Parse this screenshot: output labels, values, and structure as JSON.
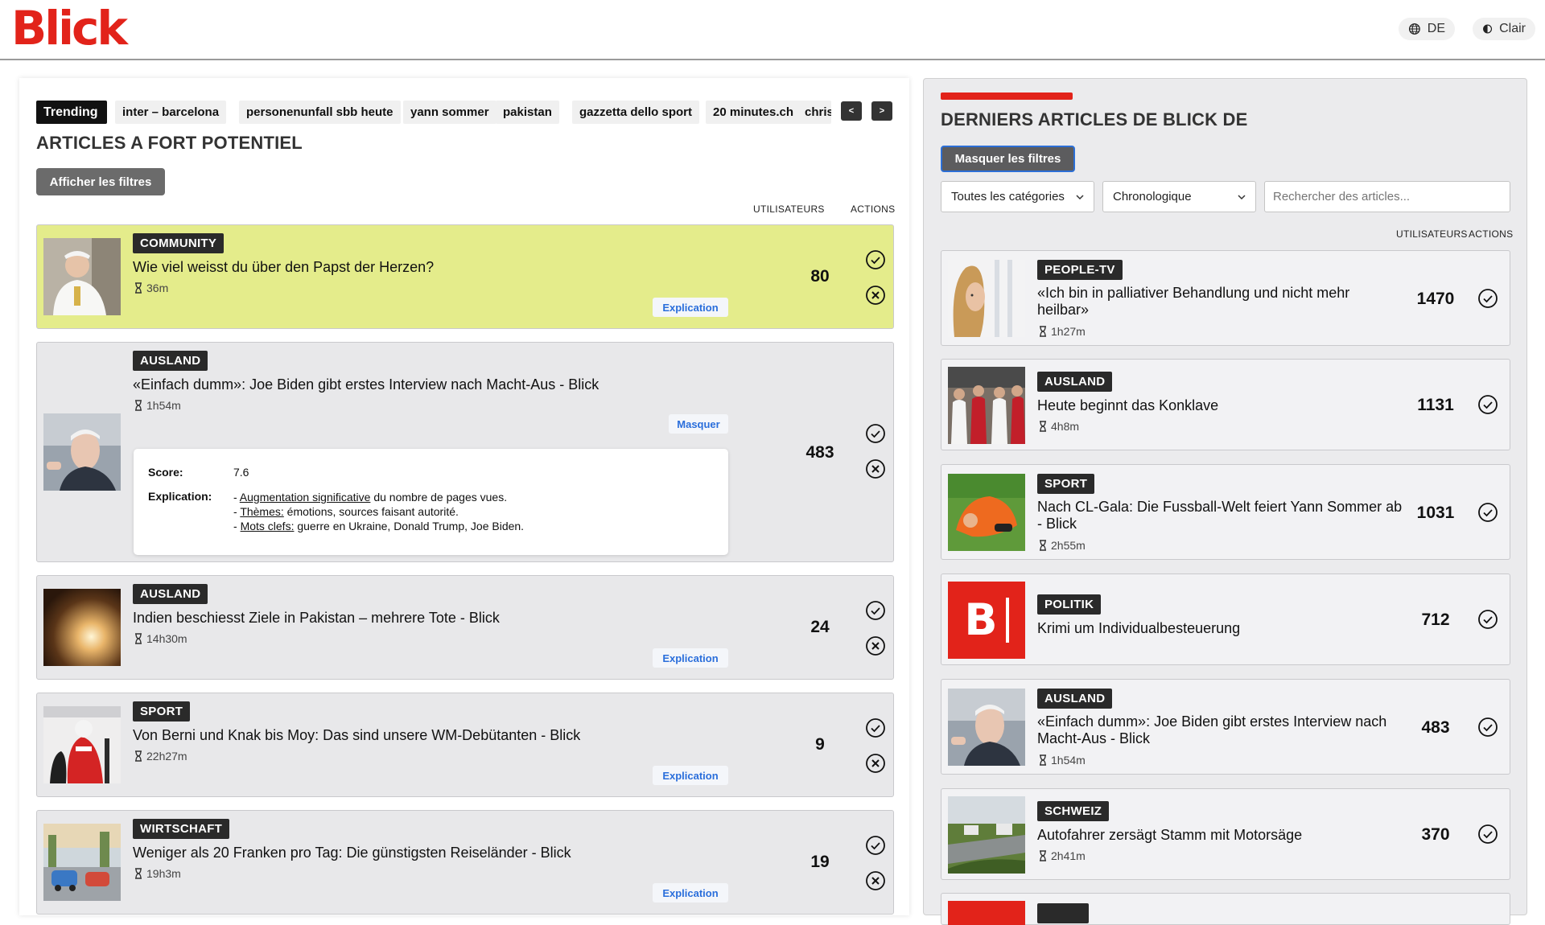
{
  "header": {
    "logo": "Blick",
    "language": "DE",
    "theme": "Clair"
  },
  "trending": {
    "label": "Trending",
    "tags": [
      "inter – barcelona",
      "personenunfall sbb heute",
      "yann sommer",
      "pakistan",
      "gazzetta dello sport",
      "20 minutes.ch",
      "chris"
    ],
    "prev": "<",
    "next": ">"
  },
  "left": {
    "title": "ARTICLES A FORT POTENTIEL",
    "filters_button": "Afficher les filtres",
    "col_users": "UTILISATEURS",
    "col_actions": "ACTIONS",
    "articles": [
      {
        "category": "COMMUNITY",
        "title": "Wie viel weisst du über den Papst der Herzen?",
        "age": "36m",
        "users": "80",
        "button": "Explication"
      },
      {
        "category": "AUSLAND",
        "title": "«Einfach dumm»: Joe Biden gibt erstes Interview nach Macht-Aus - Blick",
        "age": "1h54m",
        "users": "483",
        "button": "Masquer",
        "explanation": {
          "score_label": "Score:",
          "score": "7.6",
          "expl_label": "Explication:",
          "lines": [
            {
              "prefix": "- ",
              "term": "Augmentation significative",
              "rest": " du nombre de pages vues."
            },
            {
              "prefix": "- ",
              "term": "Thèmes:",
              "rest": " émotions, sources faisant autorité."
            },
            {
              "prefix": "- ",
              "term": "Mots clefs:",
              "rest": " guerre en Ukraine, Donald Trump, Joe Biden."
            }
          ]
        }
      },
      {
        "category": "AUSLAND",
        "title": "Indien beschiesst Ziele in Pakistan – mehrere Tote - Blick",
        "age": "14h30m",
        "users": "24",
        "button": "Explication"
      },
      {
        "category": "SPORT",
        "title": "Von Berni und Knak bis Moy: Das sind unsere WM-Debütanten - Blick",
        "age": "22h27m",
        "users": "9",
        "button": "Explication"
      },
      {
        "category": "WIRTSCHAFT",
        "title": "Weniger als 20 Franken pro Tag: Die günstigsten Reiseländer - Blick",
        "age": "19h3m",
        "users": "19",
        "button": "Explication"
      }
    ]
  },
  "right": {
    "title": "DERNIERS ARTICLES DE BLICK DE",
    "filters_button": "Masquer les filtres",
    "category_select": "Toutes les catégories",
    "order_select": "Chronologique",
    "search_placeholder": "Rechercher des articles...",
    "col_users": "UTILISATEURS",
    "col_actions": "ACTIONS",
    "articles": [
      {
        "category": "PEOPLE-TV",
        "title": "«Ich bin in palliativer Behandlung und nicht mehr heilbar»",
        "age": "1h27m",
        "users": "1470"
      },
      {
        "category": "AUSLAND",
        "title": "Heute beginnt das Konklave",
        "age": "4h8m",
        "users": "1131"
      },
      {
        "category": "SPORT",
        "title": "Nach CL-Gala: Die Fussball-Welt feiert Yann Sommer ab - Blick",
        "age": "2h55m",
        "users": "1031"
      },
      {
        "category": "POLITIK",
        "title": "Krimi um Individualbesteuerung",
        "age": "",
        "users": "712",
        "logo_letter": "B"
      },
      {
        "category": "AUSLAND",
        "title": "«Einfach dumm»: Joe Biden gibt erstes Interview nach Macht-Aus - Blick",
        "age": "1h54m",
        "users": "483"
      },
      {
        "category": "SCHWEIZ",
        "title": "Autofahrer zersägt Stamm mit Motorsäge",
        "age": "2h41m",
        "users": "370"
      }
    ]
  },
  "colors": {
    "brand": "#e2231a",
    "highlight": "#e4ec8b",
    "link": "#2a6edb"
  }
}
